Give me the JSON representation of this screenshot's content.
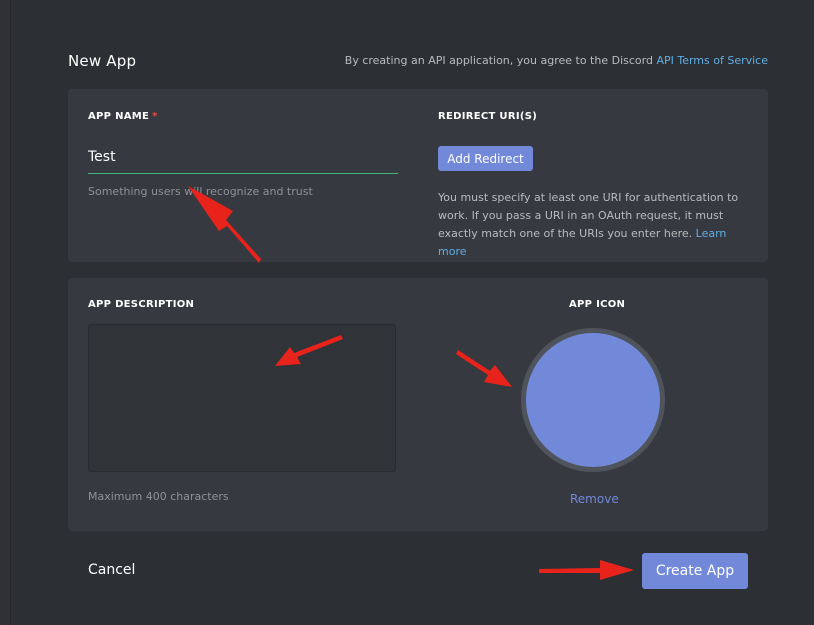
{
  "header": {
    "title": "New App",
    "tos_text": "By creating an API application, you agree to the Discord ",
    "tos_link": "API Terms of Service"
  },
  "app_name": {
    "label": "APP NAME",
    "required_mark": "*",
    "value": "Test",
    "helper": "Something users will recognize and trust"
  },
  "redirect": {
    "label": "REDIRECT URI(S)",
    "button_label": "Add Redirect",
    "note": "You must specify at least one URI for authentication to work. If you pass a URI in an OAuth request, it must exactly match one of the URIs you enter here. ",
    "learn_more": "Learn more"
  },
  "description": {
    "label": "APP DESCRIPTION",
    "value": "",
    "helper": "Maximum 400 characters"
  },
  "icon": {
    "label": "APP ICON",
    "remove_label": "Remove",
    "color": "#7289da"
  },
  "footer": {
    "cancel_label": "Cancel",
    "create_label": "Create App"
  },
  "colors": {
    "background": "#2c2f33",
    "card": "#36393f",
    "accent": "#7289da",
    "link": "#5faee3",
    "input_focus": "#43b581",
    "annotation_arrow": "#e8231b"
  }
}
